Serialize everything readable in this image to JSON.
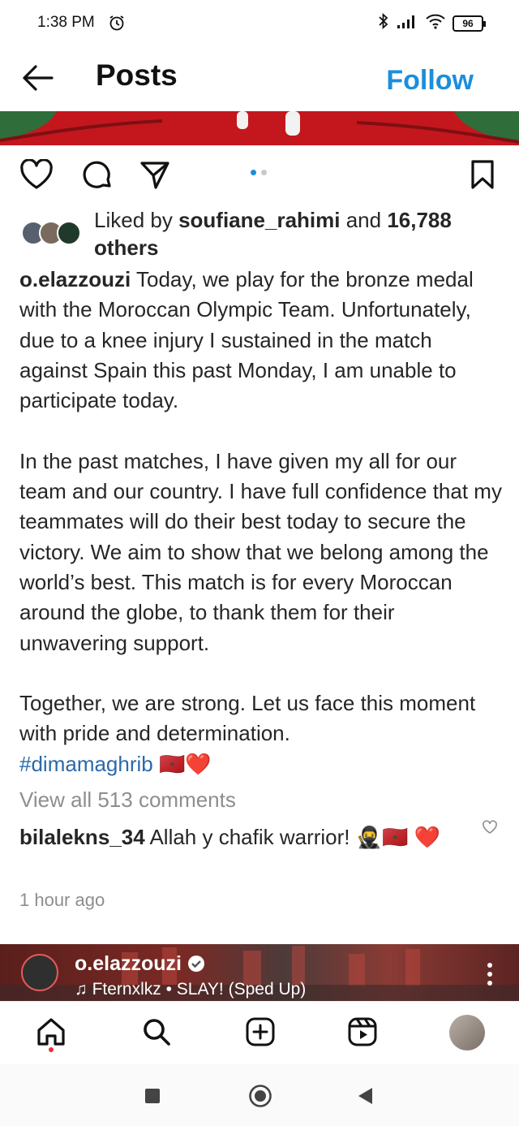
{
  "status_bar": {
    "time": "1:38 PM",
    "battery": "96"
  },
  "header": {
    "title": "Posts",
    "follow_label": "Follow"
  },
  "carousel": {
    "page_count": 2,
    "active_index": 0
  },
  "likes": {
    "prefix": "Liked by ",
    "user": "soufiane_rahimi",
    "middle": " and ",
    "count": "16,788",
    "suffix": "others"
  },
  "caption": {
    "username": "o.elazzouzi",
    "text": " Today, we play for the bronze medal with the Moroccan Olympic Team. Unfortunately, due to a knee injury I sustained in the match against Spain this past Monday, I am unable to participate today.\n\nIn the past matches, I have given my all for our team and our country. I have full confidence that my teammates will do their best today to secure the victory. We aim to show that we belong among the world’s best. This match is for every Moroccan around the globe, to thank them for their unwavering support.\n\nTogether, we are strong. Let us face this moment with pride and determination.\n",
    "hashtag": "#dimamaghrib",
    "emoji": " 🇲🇦❤️"
  },
  "comments": {
    "view_all": "View all 513 comments",
    "top_comment": {
      "username": "bilalekns_34",
      "text": " Allah y chafik warrior! 🥷🇲🇦 ❤️"
    },
    "timestamp": "1 hour ago"
  },
  "next_post": {
    "username": "o.elazzouzi",
    "music": "♫ Fternxlkz • SLAY! (Sped Up)"
  },
  "colors": {
    "accent": "#1a8fdb",
    "hashtag": "#2a6aa8",
    "muted": "#8e8e8e"
  },
  "icons": [
    "back-arrow-icon",
    "heart-icon",
    "comment-icon",
    "share-icon",
    "bookmark-icon",
    "home-icon",
    "search-icon",
    "create-icon",
    "reels-icon"
  ]
}
